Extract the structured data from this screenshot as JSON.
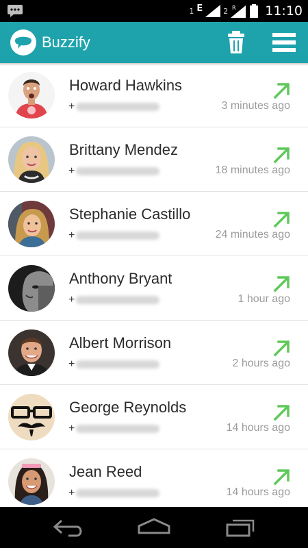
{
  "status_bar": {
    "sim1_label": "1",
    "network_type": "E",
    "sim2_label": "2",
    "roaming": "R",
    "time": "11:10"
  },
  "app_bar": {
    "title": "Buzzify",
    "logo_icon": "speech-bubble-icon",
    "delete_icon": "trash-icon",
    "menu_icon": "hamburger-menu-icon",
    "color": "#1ea3ad"
  },
  "calls": [
    {
      "name": "Howard Hawkins",
      "phone_prefix": "+",
      "time": "3 minutes ago",
      "direction_icon": "outgoing-call-arrow-icon"
    },
    {
      "name": "Brittany Mendez",
      "phone_prefix": "+",
      "time": "18 minutes ago",
      "direction_icon": "outgoing-call-arrow-icon"
    },
    {
      "name": "Stephanie Castillo",
      "phone_prefix": "+",
      "time": "24 minutes ago",
      "direction_icon": "outgoing-call-arrow-icon"
    },
    {
      "name": "Anthony Bryant",
      "phone_prefix": "+",
      "time": "1 hour ago",
      "direction_icon": "outgoing-call-arrow-icon"
    },
    {
      "name": "Albert Morrison",
      "phone_prefix": "+",
      "time": "2 hours ago",
      "direction_icon": "outgoing-call-arrow-icon"
    },
    {
      "name": "George Reynolds",
      "phone_prefix": "+",
      "time": "14 hours ago",
      "direction_icon": "outgoing-call-arrow-icon"
    },
    {
      "name": "Jean Reed",
      "phone_prefix": "+",
      "time": "14 hours ago",
      "direction_icon": "outgoing-call-arrow-icon"
    }
  ],
  "colors": {
    "accent": "#1ea3ad",
    "arrow": "#5fc85a",
    "time_text": "#9b9b9b"
  },
  "nav_bar": {
    "back_icon": "back-icon",
    "home_icon": "home-icon",
    "recents_icon": "recent-apps-icon"
  }
}
